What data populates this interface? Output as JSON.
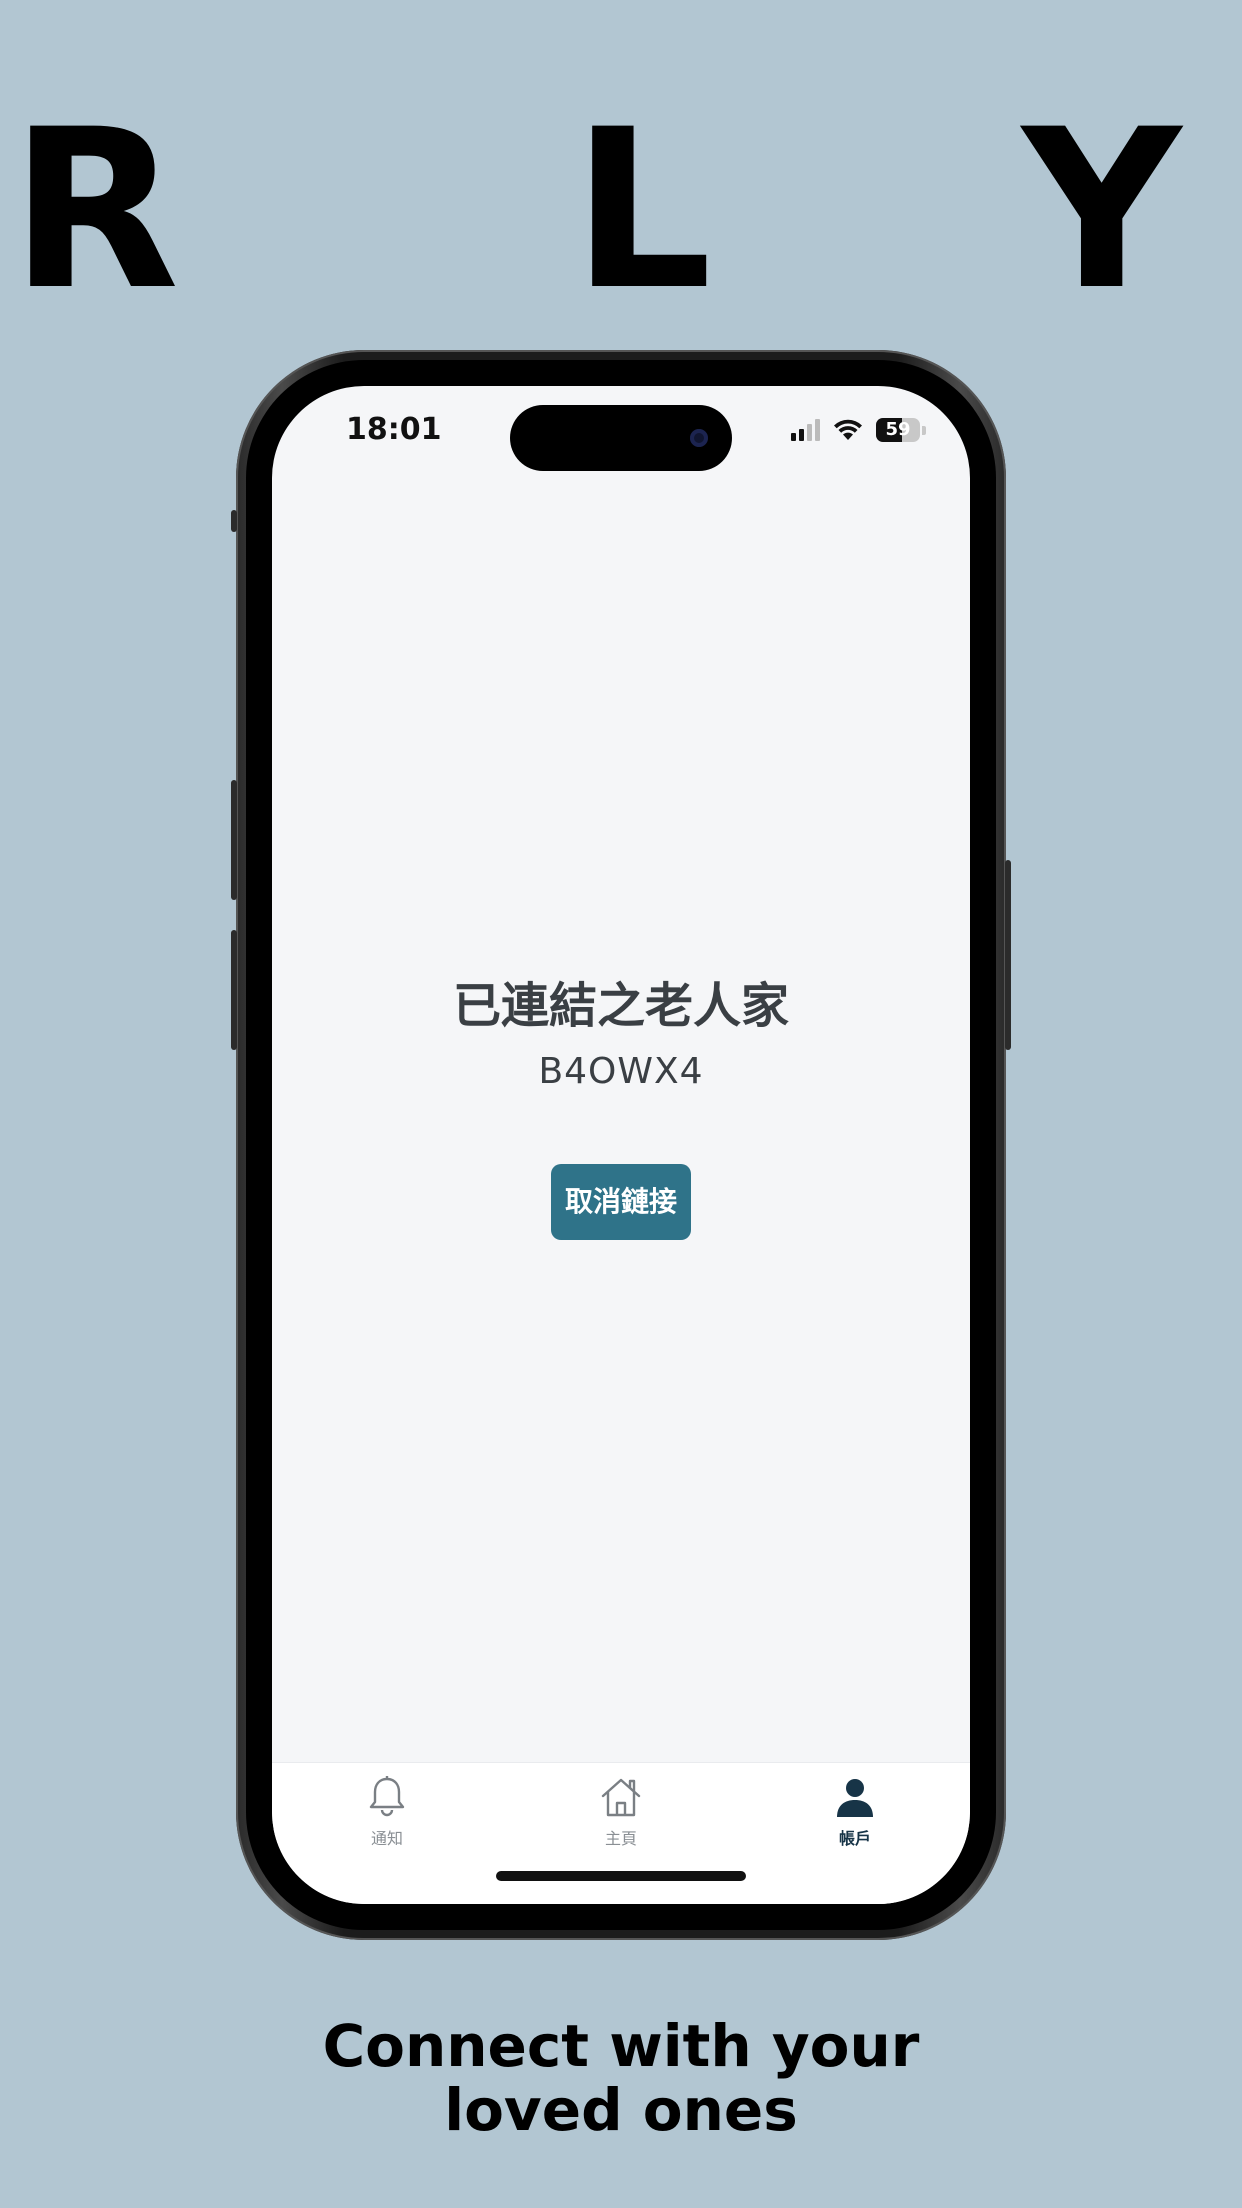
{
  "brand": {
    "letters": [
      "R",
      "L",
      "Y"
    ]
  },
  "status_bar": {
    "time": "18:01",
    "battery": "59",
    "battery_level_percent": 59,
    "icons": [
      "cellular-signal-icon",
      "wifi-icon",
      "battery-icon"
    ]
  },
  "main": {
    "title": "已連結之老人家",
    "code": "B4OWX4",
    "unlink_button_label": "取消鏈接"
  },
  "tab_bar": {
    "items": [
      {
        "label": "通知",
        "icon": "bell-icon",
        "active": false
      },
      {
        "label": "主頁",
        "icon": "home-icon",
        "active": false
      },
      {
        "label": "帳戶",
        "icon": "person-icon",
        "active": true
      }
    ]
  },
  "tagline": {
    "line1": "Connect with your",
    "line2": "loved ones"
  },
  "colors": {
    "background": "#b2c6d2",
    "screen_background": "#f5f6f8",
    "button": "#2f7389",
    "text_dark": "#3a3f44",
    "tab_active": "#173447",
    "tab_inactive": "#8a8f94"
  }
}
